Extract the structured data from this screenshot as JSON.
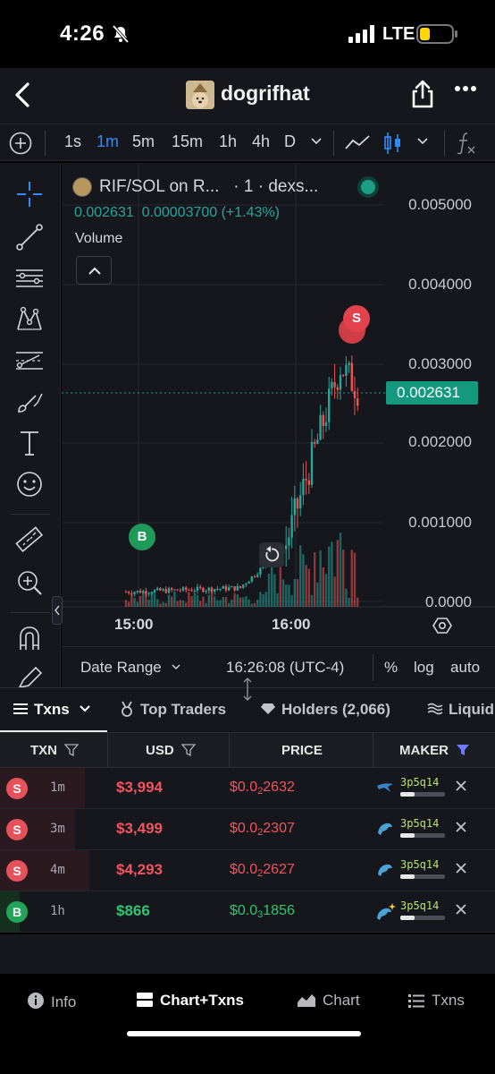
{
  "status_bar": {
    "time": "4:26",
    "network": "LTE"
  },
  "header": {
    "title": "dogrifhat"
  },
  "toolbar": {
    "intervals": [
      "1s",
      "1m",
      "5m",
      "15m",
      "1h",
      "4h",
      "D"
    ],
    "active_interval": "1m"
  },
  "chart": {
    "pair": "RIF/SOL on R...",
    "source": "· 1 · dexs...",
    "last_price": "0.002631",
    "change": "0.00003700 (+1.43%)",
    "volume_label": "Volume",
    "price_ticks": [
      "0.005000",
      "0.004000",
      "0.003000",
      "0.002000",
      "0.001000",
      "0.0000"
    ],
    "time_ticks": [
      "15:00",
      "16:00"
    ],
    "buy_marker": "B",
    "sell_marker": "S"
  },
  "chart_footer": {
    "date_range": "Date Range",
    "clock": "16:26:08 (UTC-4)",
    "percent": "%",
    "log": "log",
    "auto": "auto"
  },
  "tabs": {
    "txns": "Txns",
    "top_traders": "Top Traders",
    "holders": "Holders (2,066)",
    "liquidity": "Liquid"
  },
  "table": {
    "headers": {
      "txn": "TXN",
      "usd": "USD",
      "price": "PRICE",
      "maker": "MAKER"
    },
    "rows": [
      {
        "type": "S",
        "age": "1m",
        "usd": "$3,994",
        "price_prefix": "$0.0",
        "price_zeros": "2",
        "price_digits": "2632",
        "maker": "3p5q14"
      },
      {
        "type": "S",
        "age": "3m",
        "usd": "$3,499",
        "price_prefix": "$0.0",
        "price_zeros": "2",
        "price_digits": "2307",
        "maker": "3p5q14"
      },
      {
        "type": "S",
        "age": "4m",
        "usd": "$4,293",
        "price_prefix": "$0.0",
        "price_zeros": "2",
        "price_digits": "2627",
        "maker": "3p5q14"
      },
      {
        "type": "B",
        "age": "1h",
        "usd": "$866",
        "price_prefix": "$0.0",
        "price_zeros": "3",
        "price_digits": "1856",
        "maker": "3p5q14"
      }
    ]
  },
  "bottom_nav": {
    "info": "Info",
    "chart_txns": "Chart+Txns",
    "chart": "Chart",
    "txns": "Txns"
  },
  "colors": {
    "up": "#26a69a",
    "down": "#ef5350",
    "accent": "#2f8cff",
    "price_tag": "#149980"
  }
}
